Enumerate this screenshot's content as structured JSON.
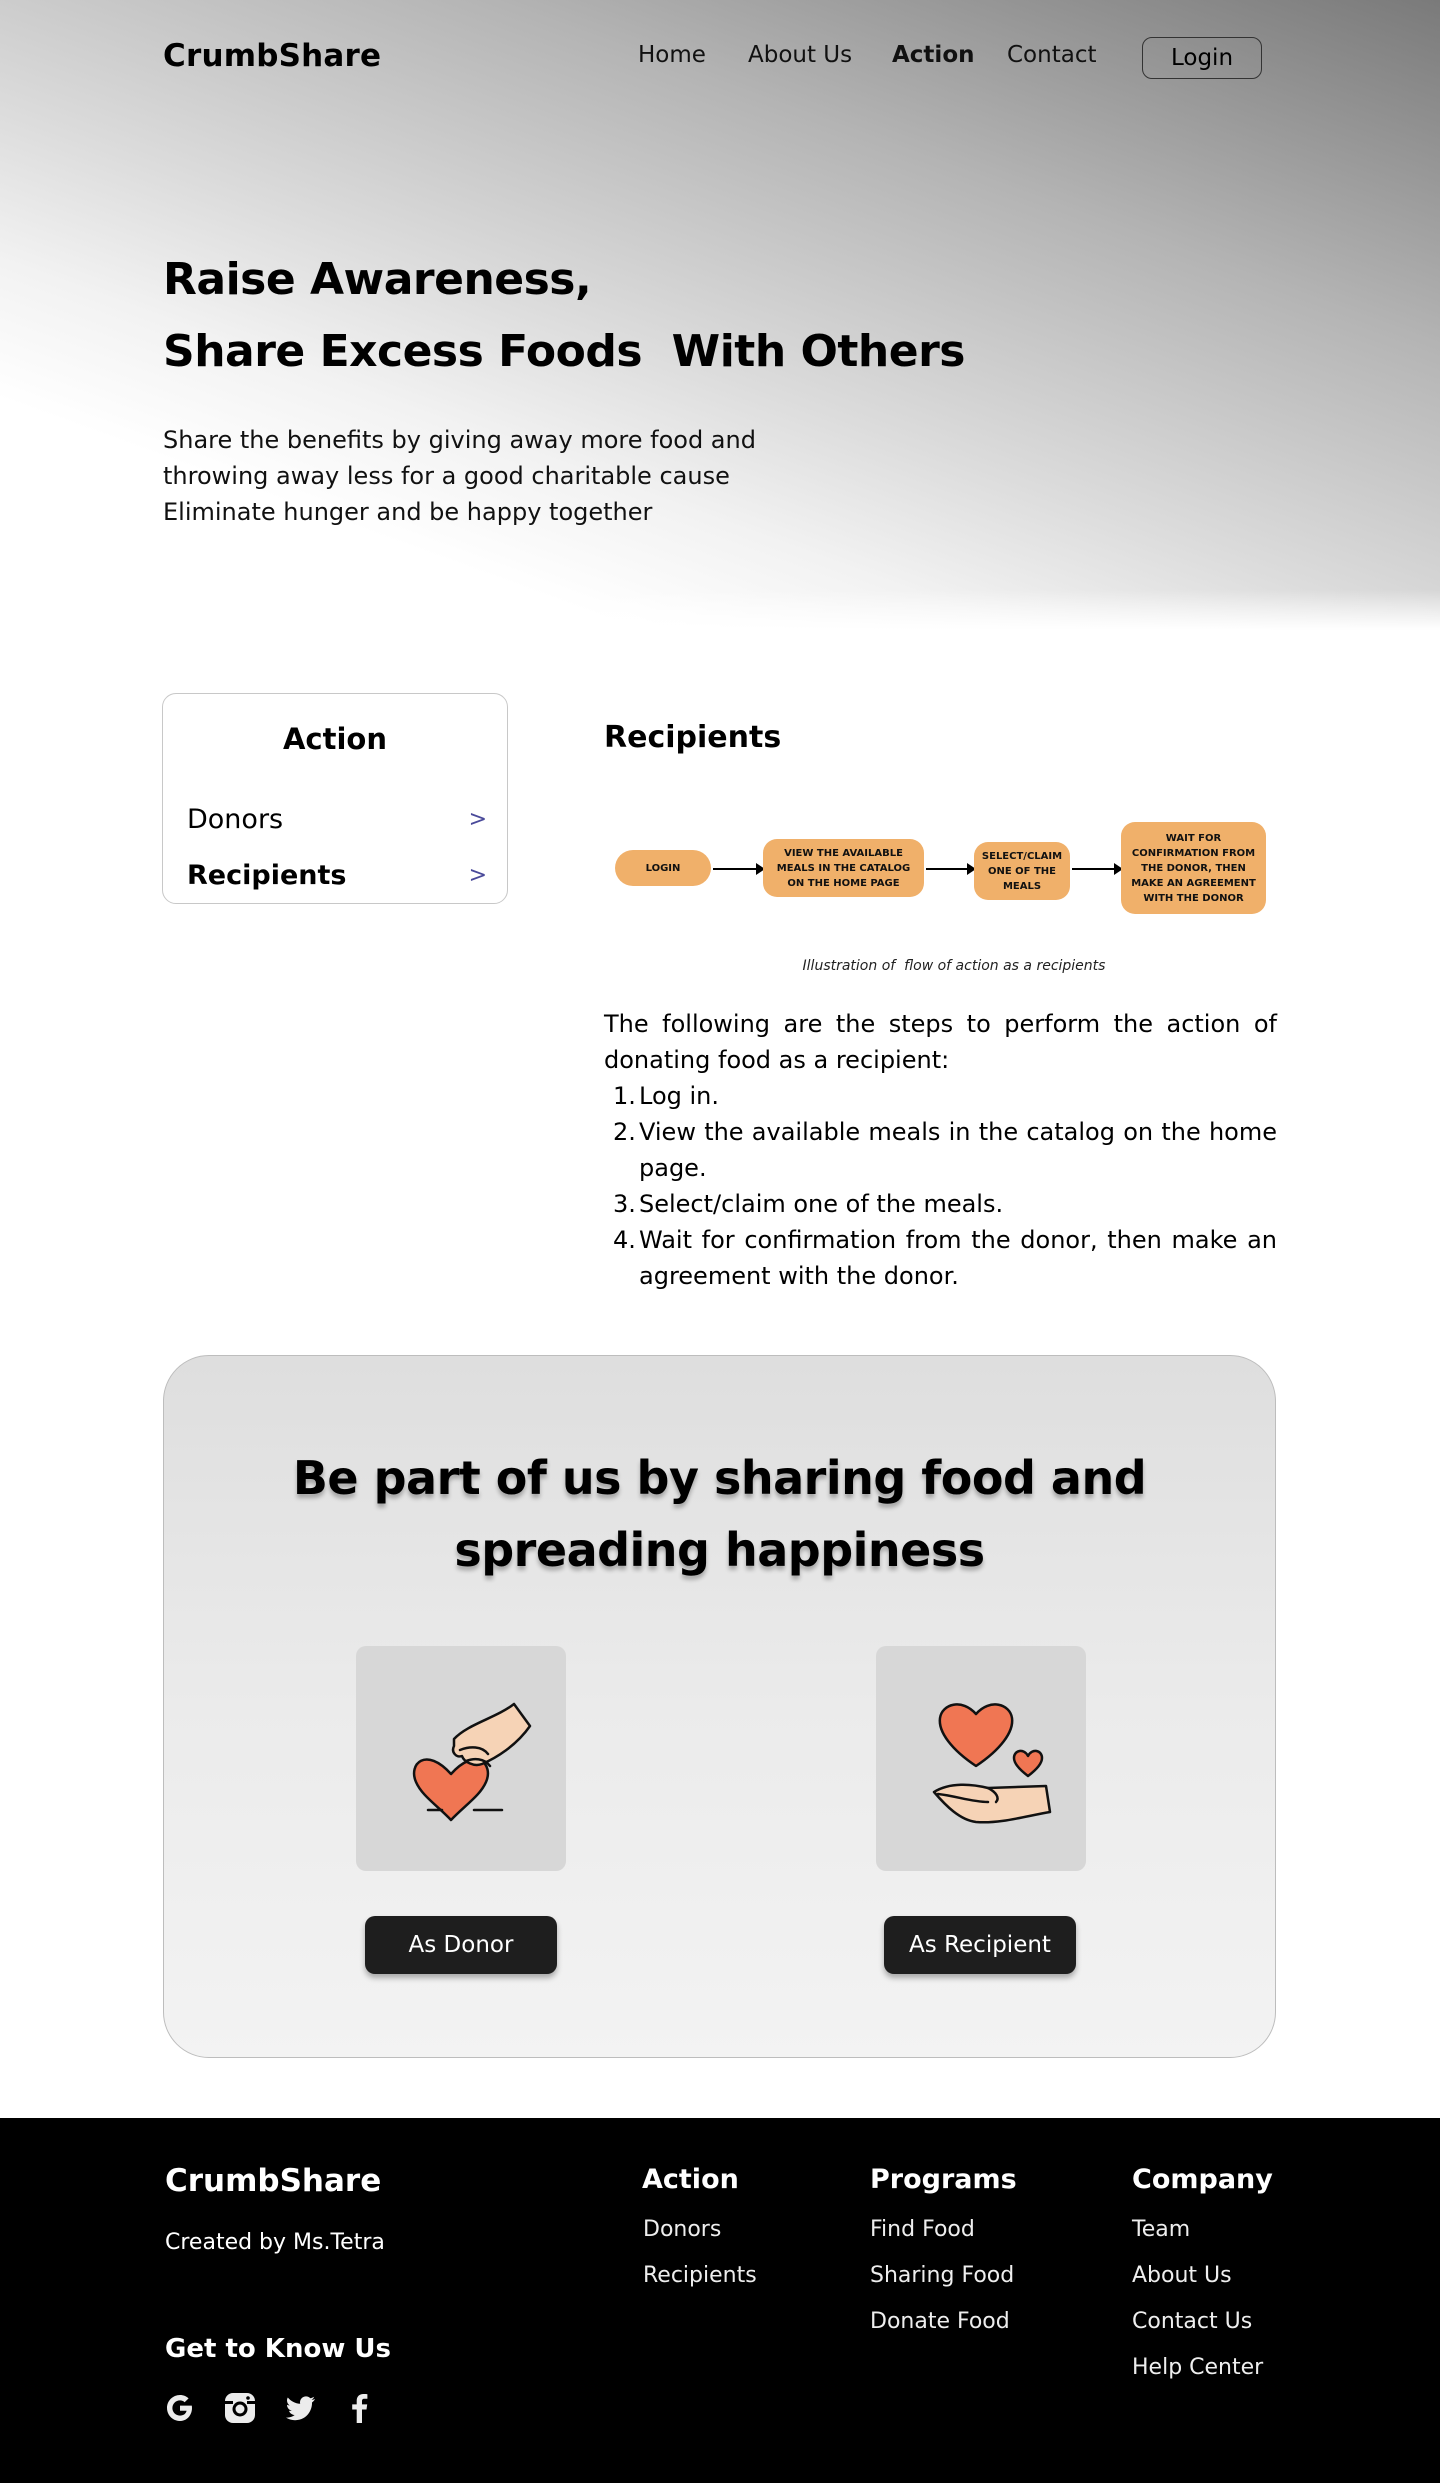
{
  "header": {
    "brand": "CrumbShare",
    "nav": [
      "Home",
      "About Us",
      "Action",
      "Contact"
    ],
    "active_nav": "Action",
    "login_label": "Login"
  },
  "hero": {
    "title_line1": "Raise Awareness,",
    "title_line2": "Share Excess Foods  With Others",
    "desc_lines": [
      "Share the benefits by giving away more food and",
      "throwing away less for a good charitable cause",
      "Eliminate hunger and be happy together"
    ]
  },
  "sidebar": {
    "title": "Action",
    "items": [
      {
        "label": "Donors",
        "chevron": ">",
        "active": false
      },
      {
        "label": "Recipients",
        "chevron": ">",
        "active": true
      }
    ]
  },
  "content": {
    "title": "Recipients",
    "flow": [
      "LOGIN",
      "VIEW THE AVAILABLE MEALS IN THE CATALOG ON THE HOME PAGE",
      "SELECT/CLAIM ONE OF THE MEALS",
      "WAIT FOR CONFIRMATION FROM THE DONOR, THEN MAKE AN AGREEMENT WITH THE DONOR"
    ],
    "flow_color": "#f0b06a",
    "caption": "Illustration of  flow of action as a recipients",
    "intro": "The following are the steps to perform the action of donating food as a recipient:",
    "steps": [
      "Log in.",
      "View the available meals in the catalog on the home page.",
      "Select/claim one of the meals.",
      "Wait for confirmation from the donor, then make an agreement with the donor."
    ]
  },
  "cta": {
    "title_line1": "Be part of us by sharing food and",
    "title_line2": "spreading happiness",
    "donor_icon": "hand-giving-heart-icon",
    "recipient_icon": "hand-receiving-heart-icon",
    "donor_button": "As Donor",
    "recipient_button": "As Recipient",
    "heart_color": "#f07653",
    "hand_color": "#f6d3b6"
  },
  "footer": {
    "brand": "CrumbShare",
    "created_by": "Created by Ms.Tetra",
    "know_title": "Get to Know Us",
    "social_icons": [
      "google-icon",
      "instagram-icon",
      "twitter-icon",
      "facebook-icon"
    ],
    "columns": [
      {
        "title": "Action",
        "links": [
          "Donors",
          "Recipients"
        ]
      },
      {
        "title": "Programs",
        "links": [
          "Find Food",
          "Sharing Food",
          "Donate Food"
        ]
      },
      {
        "title": "Company",
        "links": [
          "Team",
          "About Us",
          "Contact Us",
          "Help Center"
        ]
      }
    ]
  }
}
